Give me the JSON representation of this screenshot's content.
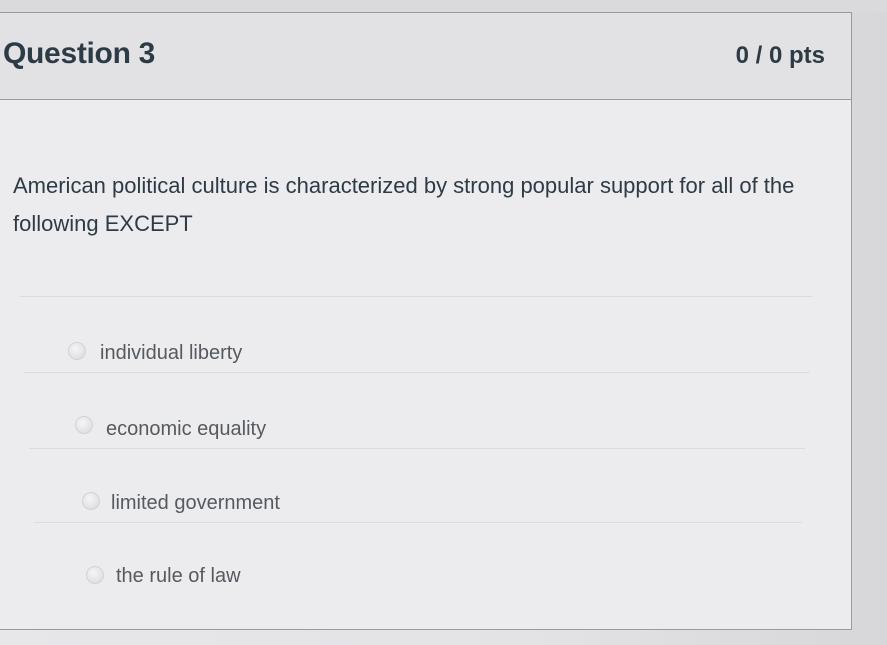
{
  "question": {
    "title": "Question 3",
    "points": "0 / 0 pts",
    "text": "American political culture is characterized by strong popular support for all of the following EXCEPT"
  },
  "answers": [
    {
      "label": "individual liberty",
      "selected": false
    },
    {
      "label": "economic equality",
      "selected": false
    },
    {
      "label": "limited government",
      "selected": false
    },
    {
      "label": "the rule of law",
      "selected": false
    }
  ]
}
